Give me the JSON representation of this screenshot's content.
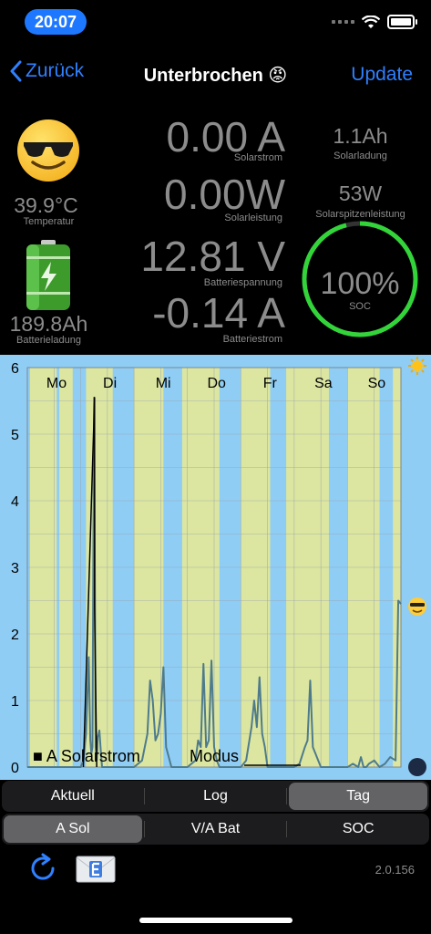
{
  "status": {
    "time": "20:07"
  },
  "nav": {
    "back_label": "Zurück",
    "title": "Unterbrochen 😡",
    "right_label": "Update"
  },
  "dashboard": {
    "temperature": {
      "value": "39.9°C",
      "label": "Temperatur"
    },
    "battery_charge": {
      "value": "189.8Ah",
      "label": "Batterieladung"
    },
    "solar_current": {
      "value": "0.00 A",
      "label": "Solarstrom"
    },
    "solar_power": {
      "value": "0.00W",
      "label": "Solarleistung"
    },
    "battery_voltage": {
      "value": "12.81 V",
      "label": "Batteriespannung"
    },
    "battery_current": {
      "value": "-0.14 A",
      "label": "Batteriestrom"
    },
    "solar_charge": {
      "value": "1.1Ah",
      "label": "Solarladung"
    },
    "solar_peak": {
      "value": "53W",
      "label": "Solarspitzenleistung"
    },
    "soc": {
      "value": "100%",
      "label": "SOC",
      "fraction": 1.0
    },
    "colors": {
      "soc_ring": "#33d43a",
      "value_text": "#8c8c8c"
    }
  },
  "chart_data": {
    "type": "line",
    "categories": [
      "Mo",
      "Di",
      "Mi",
      "Do",
      "Fr",
      "Sa",
      "So"
    ],
    "y_ticks": [
      "0",
      "1",
      "2",
      "3",
      "4",
      "5",
      "6"
    ],
    "ylim": [
      0,
      6
    ],
    "legend": [
      {
        "name": "A Solarstrom",
        "marker": "■"
      },
      {
        "name": "Modus",
        "marker": ""
      }
    ],
    "series": [
      {
        "name": "A Solarstrom",
        "color": "#4e7b8c",
        "x": [
          0,
          0.2,
          0.5,
          0.7,
          0.9,
          1.0,
          1.05,
          1.1,
          1.15,
          1.18,
          1.2,
          1.22,
          1.25,
          1.28,
          1.3,
          1.32,
          1.35,
          1.38,
          1.4,
          1.45,
          1.5,
          1.7,
          1.9,
          2.0,
          2.15,
          2.25,
          2.3,
          2.35,
          2.4,
          2.45,
          2.5,
          2.55,
          2.6,
          2.7,
          2.9,
          3.0,
          3.15,
          3.2,
          3.25,
          3.3,
          3.35,
          3.4,
          3.45,
          3.5,
          3.55,
          3.6,
          3.8,
          4.0,
          4.1,
          4.2,
          4.25,
          4.3,
          4.35,
          4.4,
          4.45,
          4.5,
          4.6,
          4.8,
          5.0,
          5.1,
          5.2,
          5.25,
          5.3,
          5.35,
          5.4,
          5.45,
          5.5,
          5.6,
          6.0,
          6.1,
          6.2,
          6.25,
          6.3,
          6.35,
          6.4,
          6.5,
          6.6,
          6.7,
          6.8,
          6.9,
          6.95,
          7.0
        ],
        "values": [
          0,
          0,
          0,
          0,
          0,
          0,
          0.1,
          0.5,
          1.65,
          0.4,
          0.2,
          0.3,
          5.55,
          0.3,
          0.1,
          0.45,
          0.55,
          0.2,
          0,
          0,
          0,
          0,
          0,
          0,
          0.1,
          0.5,
          1.3,
          1.0,
          0.4,
          0.5,
          0.8,
          1.5,
          0.3,
          0,
          0,
          0,
          0.1,
          0.4,
          0.3,
          1.55,
          0.3,
          0.4,
          1.6,
          0.3,
          0.1,
          0,
          0,
          0,
          0.1,
          0.6,
          1.0,
          0.6,
          1.35,
          0.5,
          0.3,
          0,
          0,
          0,
          0,
          0.05,
          0.3,
          0.4,
          1.3,
          0.3,
          0.2,
          0.1,
          0,
          0,
          0,
          0.05,
          0,
          0.15,
          0,
          0,
          0.05,
          0.1,
          0,
          0.05,
          0.15,
          0.1,
          2.5,
          2.45
        ]
      },
      {
        "name": "Modus",
        "color": "#000000",
        "x": [
          1.05,
          1.26,
          1.26,
          1.3
        ],
        "values": [
          0,
          5.55,
          2.4,
          0
        ]
      }
    ],
    "night_bands": [
      [
        0.0,
        0.05
      ],
      [
        0.55,
        0.6
      ],
      [
        0.85,
        1.1
      ],
      [
        1.6,
        2.0
      ],
      [
        2.55,
        2.9
      ],
      [
        3.6,
        4.0
      ],
      [
        4.55,
        4.85
      ],
      [
        5.65,
        6.0
      ],
      [
        6.6,
        6.85
      ]
    ],
    "side_icons": {
      "top": "sun-icon",
      "mid": "sunglasses-emoji-icon",
      "bottom": "moon-icon"
    },
    "colors": {
      "background": "#8fcdf5",
      "day_band": "#dce6a0",
      "grid": "#9aa4ad"
    }
  },
  "tabs_row1": {
    "items": [
      "Aktuell",
      "Log",
      "Tag"
    ],
    "selected": 2
  },
  "tabs_row2": {
    "items": [
      "A Sol",
      "V/A Bat",
      "SOC"
    ],
    "selected": 0
  },
  "footer": {
    "version": "2.0.156",
    "refresh_icon": "refresh-icon",
    "mail_icon": "mail-e-icon"
  }
}
